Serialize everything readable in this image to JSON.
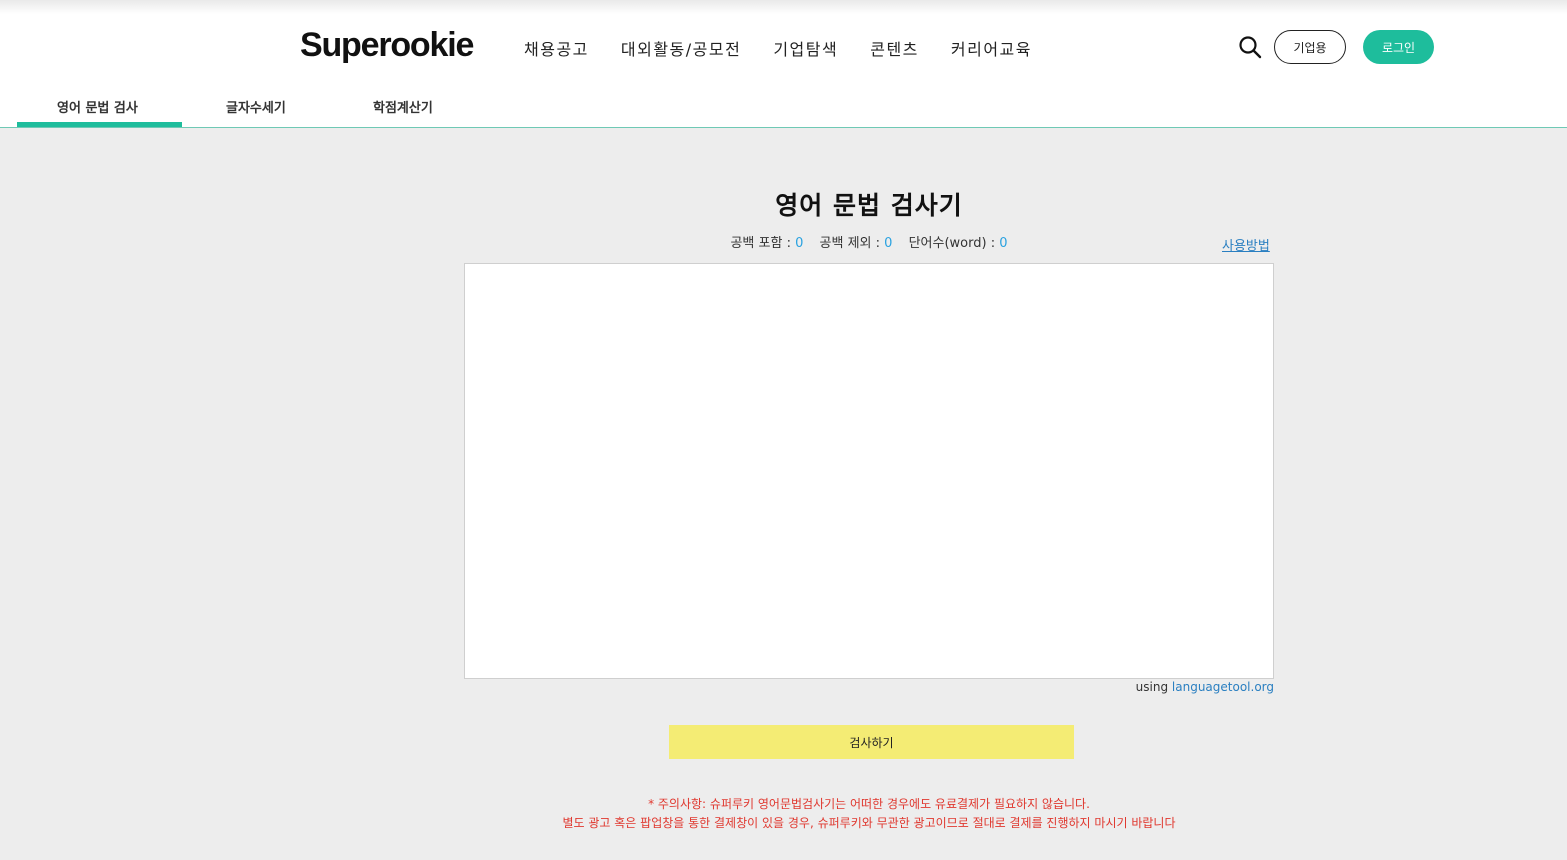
{
  "header": {
    "logo": "Superookie",
    "nav": [
      "채용공고",
      "대외활동/공모전",
      "기업탐색",
      "콘텐츠",
      "커리어교육"
    ],
    "biz_button": "기업용",
    "login_button": "로그인"
  },
  "subtabs": [
    {
      "label": "영어 문법 검사",
      "active": true
    },
    {
      "label": "글자수세기",
      "active": false
    },
    {
      "label": "학점계산기",
      "active": false
    }
  ],
  "main": {
    "title": "영어 문법 검사기",
    "counts": {
      "with_space_label": "공백 포함 :",
      "with_space_value": "0",
      "without_space_label": "공백 제외 :",
      "without_space_value": "0",
      "words_label": "단어수(word) :",
      "words_value": "0"
    },
    "howto_link": "사용방법",
    "editor_value": "",
    "using_prefix": "using",
    "using_link": "languagetool.org",
    "check_button": "검사하기",
    "notice_line1": "* 주의사항: 슈퍼루키 영어문법검사기는 어떠한 경우에도 유료결제가 필요하지 않습니다.",
    "notice_line2": "별도 광고 혹은 팝업창을 통한 결제창이 있을 경우, 슈퍼루키와 무관한 광고이므로 절대로 결제를 진행하지 마시기 바랍니다"
  },
  "colors": {
    "accent": "#1ebd9c",
    "check_button": "#f4ec74",
    "notice": "#e0382f",
    "link": "#2a7fc1",
    "count_value": "#2aa2e0"
  },
  "icons": {
    "search": "search-icon"
  }
}
